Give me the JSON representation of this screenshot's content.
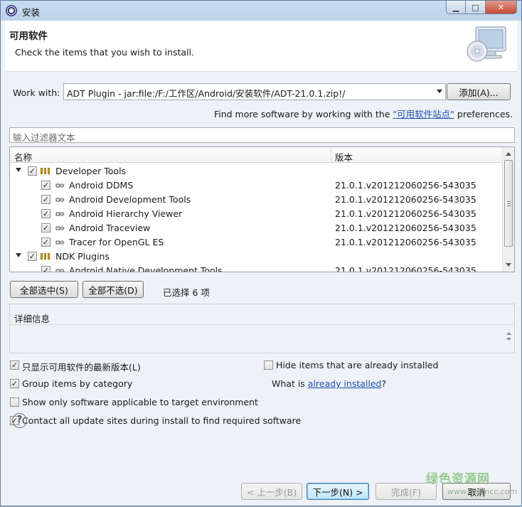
{
  "window": {
    "title": "安装",
    "controls": [
      "minimize",
      "maximize",
      "close"
    ]
  },
  "header": {
    "title": "可用软件",
    "description": "Check the items that you wish to install."
  },
  "work_with": {
    "label": "Work with:",
    "value": "ADT Plugin - jar:file:/F:/工作区/Android/安装软件/ADT-21.0.1.zip!/",
    "add_button": "添加(A)..."
  },
  "find_more": {
    "prefix": "Find more software by working with the",
    "link": "\"可用软件站点\"",
    "suffix": "preferences."
  },
  "filter": {
    "placeholder": "输入过滤器文本"
  },
  "tree": {
    "columns": {
      "name": "名称",
      "version": "版本"
    },
    "groups": [
      {
        "label": "Developer Tools",
        "checked": true,
        "expanded": true,
        "items": [
          {
            "label": "Android DDMS",
            "version": "21.0.1.v201212060256-543035",
            "checked": true
          },
          {
            "label": "Android Development Tools",
            "version": "21.0.1.v201212060256-543035",
            "checked": true
          },
          {
            "label": "Android Hierarchy Viewer",
            "version": "21.0.1.v201212060256-543035",
            "checked": true
          },
          {
            "label": "Android Traceview",
            "version": "21.0.1.v201212060256-543035",
            "checked": true
          },
          {
            "label": "Tracer for OpenGL ES",
            "version": "21.0.1.v201212060256-543035",
            "checked": true
          }
        ]
      },
      {
        "label": "NDK Plugins",
        "checked": true,
        "expanded": true,
        "items": [
          {
            "label": "Android Native Development Tools",
            "version": "21.0.1.v201212060256-543035",
            "checked": true
          }
        ]
      }
    ]
  },
  "selection": {
    "select_all": "全部选中(S)",
    "deselect_all": "全部不选(D)",
    "status": "已选择 6 项"
  },
  "details": {
    "title": "详细信息"
  },
  "options": {
    "latest_only": {
      "label": "只显示可用软件的最新版本(L)",
      "checked": true
    },
    "hide_installed": {
      "label": "Hide items that are already installed",
      "checked": false
    },
    "group_by_category": {
      "label": "Group items by category",
      "checked": true
    },
    "what_is": {
      "prefix": "What is",
      "link": "already installed",
      "suffix": "?"
    },
    "target_env": {
      "label": "Show only software applicable to target environment",
      "checked": false
    },
    "contact_sites": {
      "label": "Contact all update sites during install to find required software",
      "checked": true
    }
  },
  "footer": {
    "help_icon": "?",
    "back": "< 上一步(B)",
    "next": "下一步(N) >",
    "finish": "完成(F)",
    "cancel": "取消"
  },
  "watermark": {
    "main": "绿色资源网",
    "sub": "www.downcc.com"
  },
  "colors": {
    "link": "#1a4fb3",
    "title_bar": "#bcd2ea",
    "dialog_bg": "#eef2f7",
    "close_button": "#c54a34"
  }
}
